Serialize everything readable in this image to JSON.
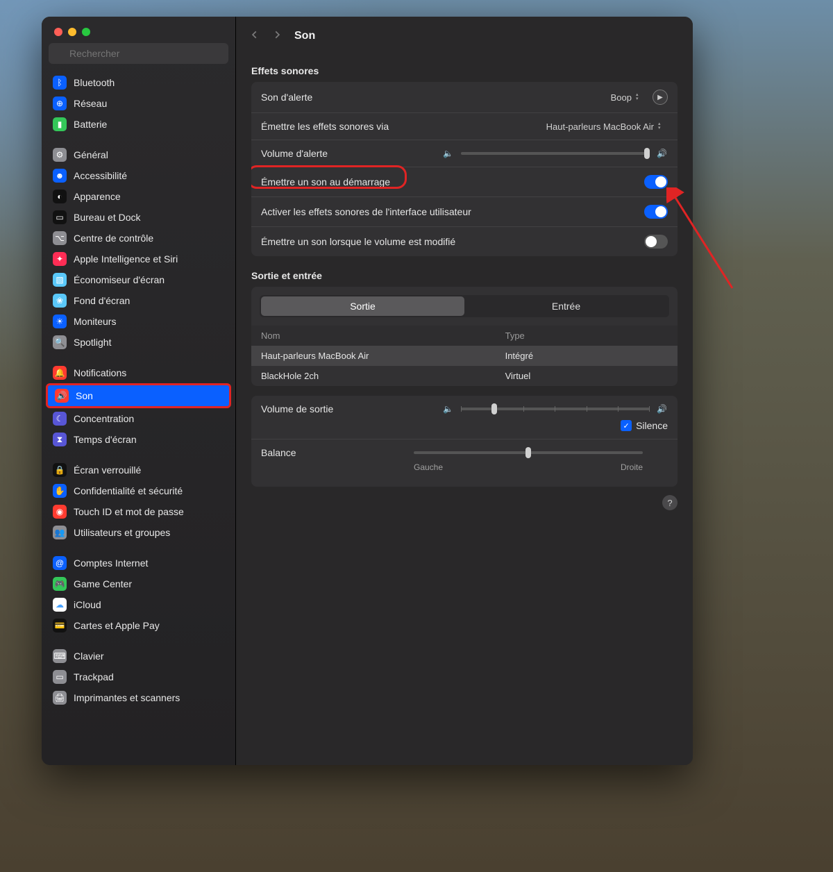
{
  "page_title": "Son",
  "search_placeholder": "Rechercher",
  "sidebar_groups": [
    [
      {
        "label": "Bluetooth",
        "color": "#0a60ff",
        "glyph": "ᛒ"
      },
      {
        "label": "Réseau",
        "color": "#0a60ff",
        "glyph": "⊕"
      },
      {
        "label": "Batterie",
        "color": "#34c759",
        "glyph": "▮"
      }
    ],
    [
      {
        "label": "Général",
        "color": "#8e8e93",
        "glyph": "⚙"
      },
      {
        "label": "Accessibilité",
        "color": "#0a60ff",
        "glyph": "☻"
      },
      {
        "label": "Apparence",
        "color": "#111",
        "glyph": "◐"
      },
      {
        "label": "Bureau et Dock",
        "color": "#111",
        "glyph": "▭"
      },
      {
        "label": "Centre de contrôle",
        "color": "#8e8e93",
        "glyph": "⌥"
      },
      {
        "label": "Apple Intelligence et Siri",
        "color": "#ff2d55",
        "glyph": "✦"
      },
      {
        "label": "Économiseur d'écran",
        "color": "#5ac8fa",
        "glyph": "▧"
      },
      {
        "label": "Fond d'écran",
        "color": "#5ac8fa",
        "glyph": "❀"
      },
      {
        "label": "Moniteurs",
        "color": "#0a60ff",
        "glyph": "☀"
      },
      {
        "label": "Spotlight",
        "color": "#8e8e93",
        "glyph": "🔍"
      }
    ],
    [
      {
        "label": "Notifications",
        "color": "#ff3b30",
        "glyph": "🔔"
      },
      {
        "label": "Son",
        "color": "#ff3b30",
        "glyph": "🔊",
        "selected": true
      },
      {
        "label": "Concentration",
        "color": "#5856d6",
        "glyph": "☾"
      },
      {
        "label": "Temps d'écran",
        "color": "#5856d6",
        "glyph": "⧗"
      }
    ],
    [
      {
        "label": "Écran verrouillé",
        "color": "#111",
        "glyph": "🔒"
      },
      {
        "label": "Confidentialité et sécurité",
        "color": "#0a60ff",
        "glyph": "✋"
      },
      {
        "label": "Touch ID et mot de passe",
        "color": "#ff3b30",
        "glyph": "◉"
      },
      {
        "label": "Utilisateurs et groupes",
        "color": "#8e8e93",
        "glyph": "👥"
      }
    ],
    [
      {
        "label": "Comptes Internet",
        "color": "#0a60ff",
        "glyph": "@"
      },
      {
        "label": "Game Center",
        "color": "#34c759",
        "glyph": "🎮"
      },
      {
        "label": "iCloud",
        "color": "#ffffff",
        "glyph": "☁"
      },
      {
        "label": "Cartes et Apple Pay",
        "color": "#111",
        "glyph": "💳"
      }
    ],
    [
      {
        "label": "Clavier",
        "color": "#8e8e93",
        "glyph": "⌨"
      },
      {
        "label": "Trackpad",
        "color": "#8e8e93",
        "glyph": "▭"
      },
      {
        "label": "Imprimantes et scanners",
        "color": "#8e8e93",
        "glyph": "🖨"
      }
    ]
  ],
  "sections": {
    "effects_heading": "Effets sonores",
    "alert_sound_label": "Son d'alerte",
    "alert_sound_value": "Boop",
    "play_effects_label": "Émettre les effets sonores via",
    "play_effects_value": "Haut-parleurs MacBook Air",
    "alert_volume_label": "Volume d'alerte",
    "startup_sound_label": "Émettre un son au démarrage",
    "startup_sound_on": true,
    "ui_sound_label": "Activer les effets sonores de l'interface utilisateur",
    "ui_sound_on": true,
    "volume_change_label": "Émettre un son lorsque le volume est modifié",
    "volume_change_on": false,
    "io_heading": "Sortie et entrée",
    "tab_output": "Sortie",
    "tab_input": "Entrée",
    "col_name": "Nom",
    "col_type": "Type",
    "output_devices": [
      {
        "name": "Haut-parleurs MacBook Air",
        "type": "Intégré",
        "selected": true
      },
      {
        "name": "BlackHole 2ch",
        "type": "Virtuel",
        "selected": false
      }
    ],
    "output_volume_label": "Volume de sortie",
    "mute_label": "Silence",
    "balance_label": "Balance",
    "balance_left": "Gauche",
    "balance_right": "Droite"
  }
}
